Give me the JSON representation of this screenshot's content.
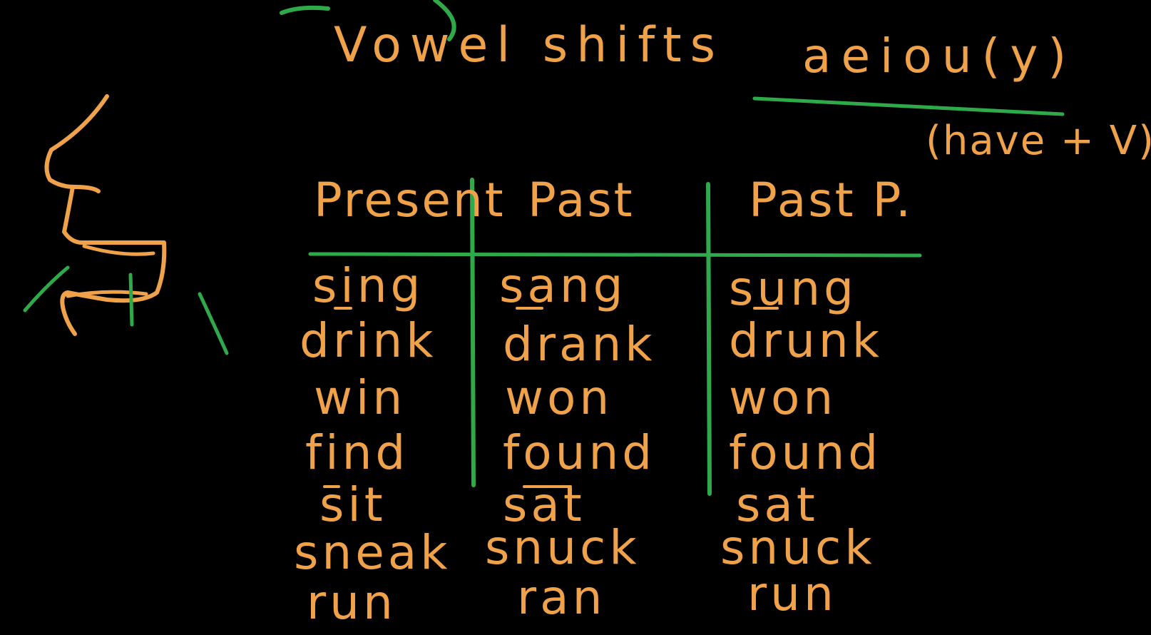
{
  "title": "Vowel shifts",
  "vowels": "aeiou(y)",
  "note": "(have + V)",
  "table": {
    "headers": [
      "Present",
      "Past",
      "Past P."
    ],
    "rows": [
      [
        "sing",
        "sang",
        "sung"
      ],
      [
        "drink",
        "drank",
        "drunk"
      ],
      [
        "win",
        "won",
        "won"
      ],
      [
        "find",
        "found",
        "found"
      ],
      [
        "sit",
        "sat",
        "sat"
      ],
      [
        "sneak",
        "snuck",
        "snuck"
      ],
      [
        "run",
        "ran",
        "run"
      ]
    ]
  },
  "colors": {
    "background": "#000000",
    "ink_orange": "#f0a24a",
    "ink_green": "#2faa4a"
  }
}
